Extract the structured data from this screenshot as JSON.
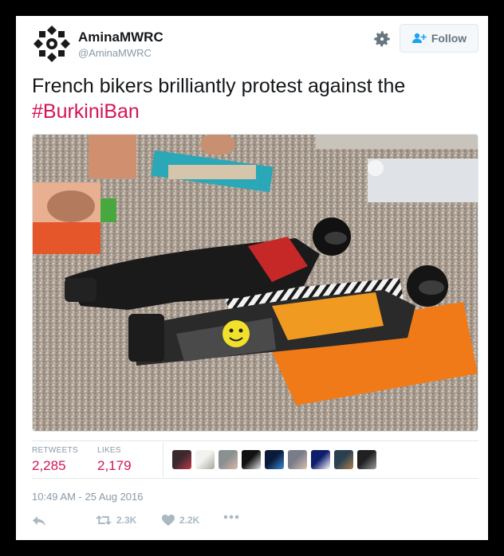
{
  "user": {
    "name": "AminaMWRC",
    "handle": "@AminaMWRC"
  },
  "follow_label": "Follow",
  "tweet": {
    "text": "French bikers brilliantly protest against the",
    "hashtag": "#BurkiniBan"
  },
  "stats": {
    "retweets_label": "RETWEETS",
    "retweets_count": "2,285",
    "likes_label": "LIKES",
    "likes_count": "2,179"
  },
  "timestamp": "10:49 AM - 25 Aug 2016",
  "actions": {
    "retweet_count": "2.3K",
    "like_count": "2.2K"
  },
  "likers": [
    {
      "colors": [
        "#3a2a30",
        "#c0364a"
      ]
    },
    {
      "colors": [
        "#f2f2ee",
        "#a8a89c"
      ]
    },
    {
      "colors": [
        "#8a8f90",
        "#d7b8a8"
      ]
    },
    {
      "colors": [
        "#111111",
        "#e6e6e6"
      ]
    },
    {
      "colors": [
        "#0a1a3a",
        "#3a8ad8"
      ]
    },
    {
      "colors": [
        "#7a7c8a",
        "#d8c0b0"
      ]
    },
    {
      "colors": [
        "#0d1d6a",
        "#ffffff"
      ]
    },
    {
      "colors": [
        "#2a4050",
        "#b08050"
      ]
    },
    {
      "colors": [
        "#202020",
        "#9a9a9a"
      ]
    }
  ],
  "colors": {
    "hashtag": "#d4145a",
    "stat_value": "#d4145a",
    "muted": "#8899a6",
    "border": "#e1e8ed"
  }
}
